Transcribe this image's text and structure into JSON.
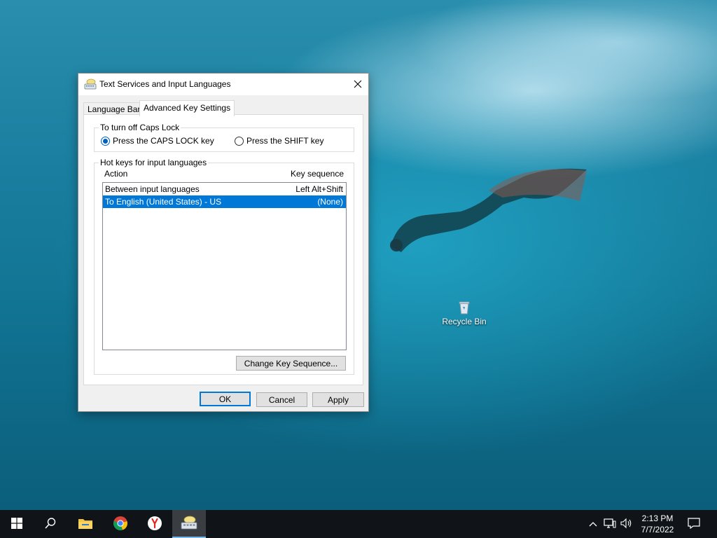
{
  "desktop": {
    "recycle_bin_label": "Recycle Bin"
  },
  "dialog": {
    "title": "Text Services and Input Languages",
    "tabs": [
      {
        "label": "Language Bar",
        "active": false
      },
      {
        "label": "Advanced Key Settings",
        "active": true
      }
    ],
    "caps_lock_group": {
      "legend": "To turn off Caps Lock",
      "options": [
        {
          "label": "Press the CAPS LOCK key",
          "selected": true
        },
        {
          "label": "Press the SHIFT key",
          "selected": false
        }
      ]
    },
    "hotkeys_group": {
      "legend": "Hot keys for input languages",
      "columns": [
        "Action",
        "Key sequence"
      ],
      "rows": [
        {
          "action": "Between input languages",
          "sequence": "Left Alt+Shift",
          "selected": false
        },
        {
          "action": "To English (United States) - US",
          "sequence": "(None)",
          "selected": true
        }
      ],
      "change_button": "Change Key Sequence..."
    },
    "buttons": {
      "ok": "OK",
      "cancel": "Cancel",
      "apply": "Apply"
    }
  },
  "taskbar": {
    "time": "2:13 PM",
    "date": "7/7/2022",
    "apps": [
      "start-icon",
      "search-icon",
      "file-explorer-icon",
      "chrome-icon",
      "yandex-icon",
      "input-languages-icon"
    ]
  },
  "colors": {
    "selection": "#0078d7",
    "taskbar": "#101317",
    "accent": "#0060c0"
  }
}
